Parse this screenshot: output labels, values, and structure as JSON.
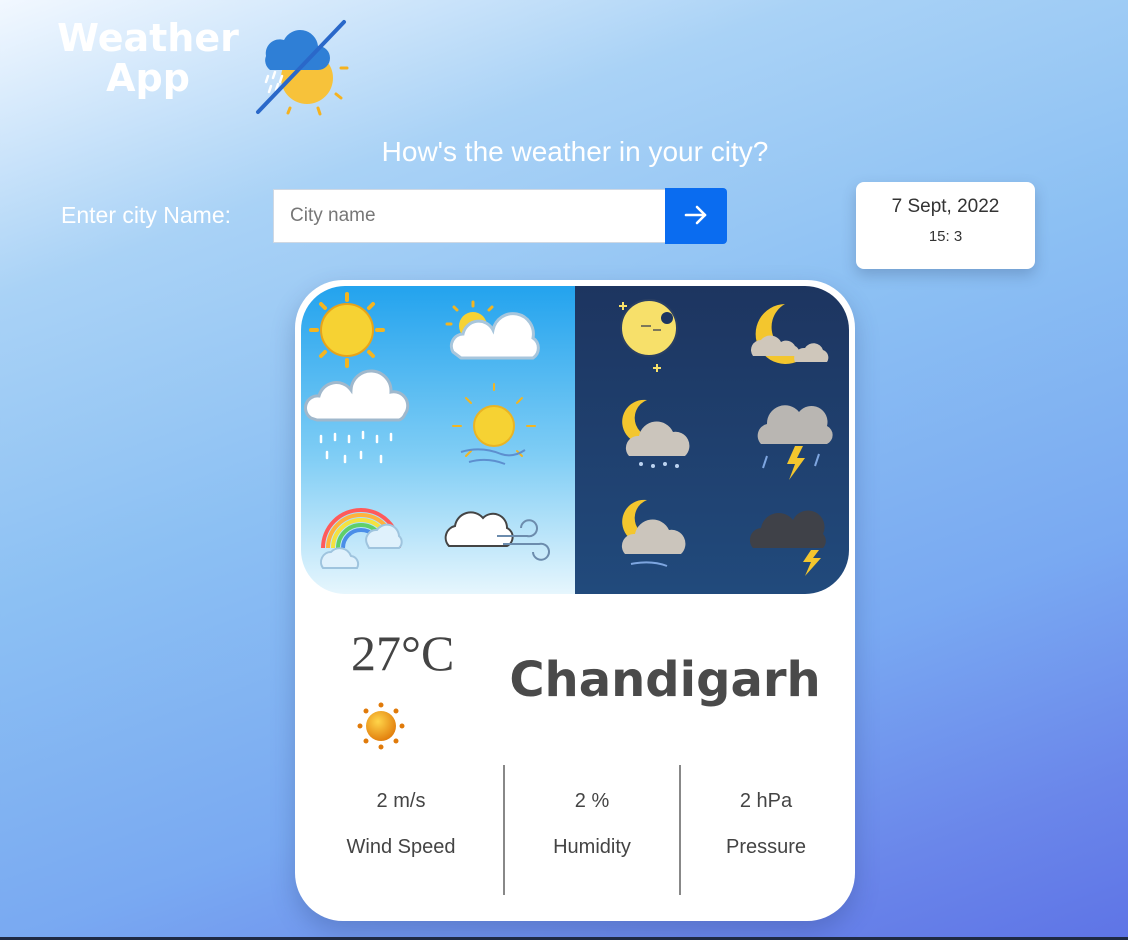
{
  "header": {
    "title_line1": "Weather",
    "title_line2": "App",
    "logo_icon": "weather-cloud-sun-icon"
  },
  "headline": "How's the weather in your city?",
  "search": {
    "label": "Enter city Name:",
    "placeholder": "City name",
    "value": "",
    "button_icon": "arrow-right-icon"
  },
  "datetime": {
    "date": "7 Sept, 2022",
    "time": "15: 3"
  },
  "weather": {
    "temperature": "27°C",
    "condition_icon": "sun-icon",
    "city": "Chandigarh",
    "stats": [
      {
        "value": "2 m/s",
        "label": "Wind Speed"
      },
      {
        "value": "2 %",
        "label": "Humidity"
      },
      {
        "value": "2 hPa",
        "label": "Pressure"
      }
    ]
  },
  "colors": {
    "accent": "#0a6cf0",
    "text_dark": "#444444",
    "day_sky": "#2fa6ee",
    "night_sky": "#1f3f6e"
  }
}
